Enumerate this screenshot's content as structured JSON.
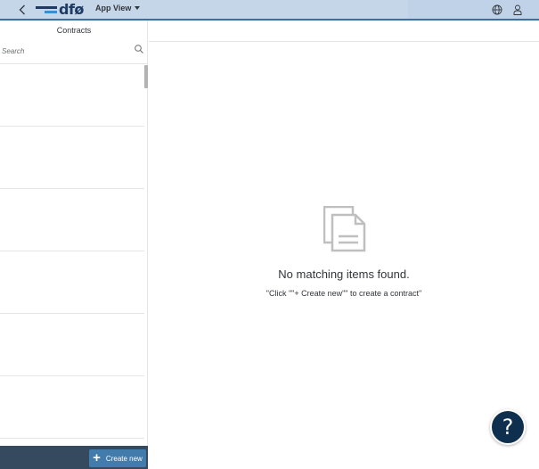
{
  "header": {
    "back_icon": "chevron-left-icon",
    "logo_text": "dfø",
    "app_view_label": "App View",
    "globe_icon": "globe-icon",
    "user_icon": "user-icon"
  },
  "master": {
    "title": "Contracts",
    "search": {
      "placeholder": "Search",
      "value": "",
      "icon": "search-icon"
    },
    "list_items": [
      {
        "label": ""
      },
      {
        "label": ""
      },
      {
        "label": ""
      },
      {
        "label": ""
      },
      {
        "label": ""
      },
      {
        "label": ""
      }
    ],
    "footer": {
      "create_label": "Create new",
      "create_icon": "plus-icon"
    }
  },
  "detail": {
    "empty_title": "No matching items found.",
    "empty_description": "\"Click \"\"+ Create new\"\" to create a contract\"",
    "empty_icon": "document-icon"
  },
  "help": {
    "label": "?",
    "icon": "help-icon"
  },
  "colors": {
    "shell_bg": "#c5d6e9",
    "shell_border": "#3a6ea5",
    "footer_bg": "#354a5f",
    "button_bg": "#427cac",
    "help_bg": "#0e2f4d"
  }
}
